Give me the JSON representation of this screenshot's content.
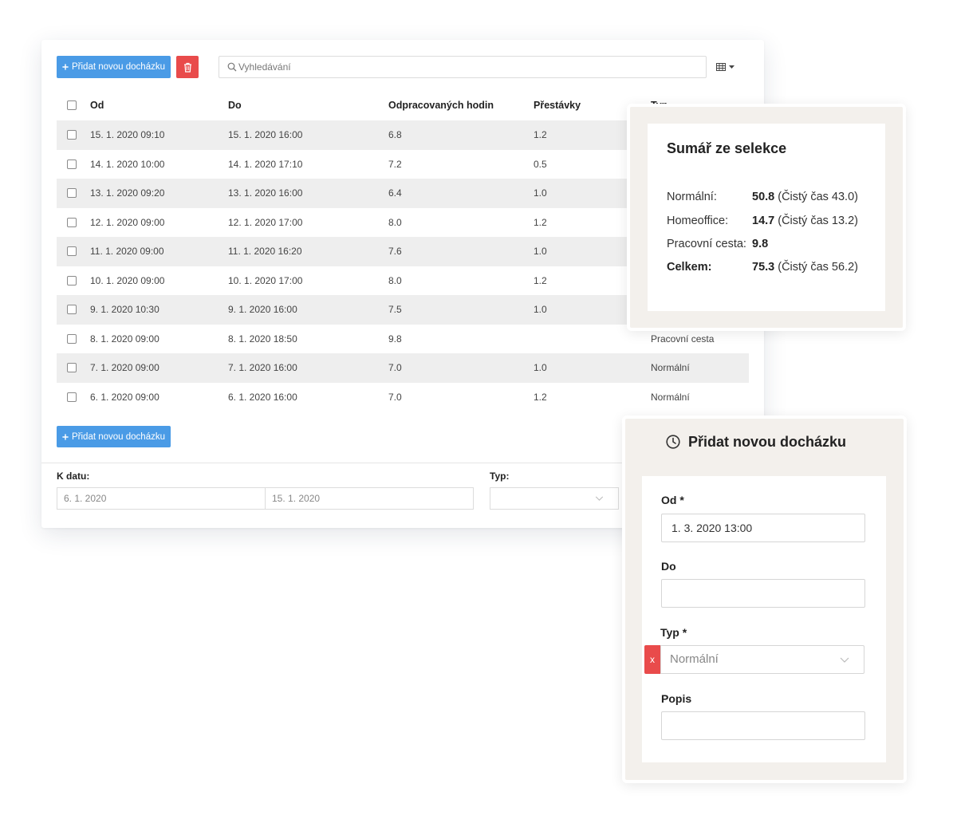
{
  "colors": {
    "primary": "#4a9be6",
    "danger": "#e94b4b",
    "panel_bg": "#f3f0ec",
    "stripe": "#eeeeee"
  },
  "toolbar": {
    "add_button": {
      "icon": "plus-icon",
      "label": "Přidat novou docházku"
    },
    "delete_button": {
      "icon": "trash-icon"
    },
    "search": {
      "icon": "search-icon",
      "placeholder": "Vyhledávání"
    },
    "columns_toggle": {
      "icon": "table-icon"
    }
  },
  "table": {
    "columns": {
      "od": "Od",
      "do": "Do",
      "hours": "Odpracovaných hodin",
      "breaks": "Přestávky",
      "type": "Typ"
    },
    "rows": [
      {
        "od": "15. 1. 2020 09:10",
        "do": "15. 1. 2020 16:00",
        "hours": "6.8",
        "breaks": "1.2"
      },
      {
        "od": "14. 1. 2020 10:00",
        "do": "14. 1. 2020 17:10",
        "hours": "7.2",
        "breaks": "0.5"
      },
      {
        "od": "13. 1. 2020 09:20",
        "do": "13. 1. 2020 16:00",
        "hours": "6.4",
        "breaks": "1.0"
      },
      {
        "od": "12. 1. 2020 09:00",
        "do": "12. 1. 2020 17:00",
        "hours": "8.0",
        "breaks": "1.2"
      },
      {
        "od": "11. 1. 2020 09:00",
        "do": "11. 1. 2020 16:20",
        "hours": "7.6",
        "breaks": "1.0"
      },
      {
        "od": "10. 1. 2020 09:00",
        "do": "10. 1. 2020 17:00",
        "hours": "8.0",
        "breaks": "1.2"
      },
      {
        "od": "9. 1. 2020 10:30",
        "do": "9. 1. 2020 16:00",
        "hours": "7.5",
        "breaks": "1.0"
      },
      {
        "od": "8. 1. 2020 09:00",
        "do": "8. 1. 2020 18:50",
        "hours": "9.8",
        "type": "Pracovní cesta"
      },
      {
        "od": "7. 1. 2020 09:00",
        "do": "7. 1. 2020 16:00",
        "hours": "7.0",
        "breaks": "1.0",
        "type": "Normální"
      },
      {
        "od": "6. 1. 2020 09:00",
        "do": "6. 1. 2020 16:00",
        "hours": "7.0",
        "breaks": "1.2",
        "type": "Normální"
      }
    ]
  },
  "footer": {
    "add_button": {
      "icon": "plus-icon",
      "label": "Přidat novou docházku"
    }
  },
  "filters": {
    "date_label": "K datu:",
    "date_from": "6. 1. 2020",
    "date_to": "15. 1. 2020",
    "type_label": "Typ:"
  },
  "summary": {
    "title": "Sumář ze selekce",
    "rows": [
      {
        "label": "Normální:",
        "value": "50.8",
        "detail": "(Čistý čas 43.0)"
      },
      {
        "label": "Homeoffice:",
        "value": "14.7",
        "detail": "(Čistý čas 13.2)"
      },
      {
        "label": "Pracovní cesta:",
        "value": "9.8"
      },
      {
        "label": "Celkem:",
        "value": "75.3",
        "detail": "(Čistý čas 56.2)"
      }
    ]
  },
  "form": {
    "icon": "clock-icon",
    "title": "Přidat novou docházku",
    "fields": {
      "od": {
        "label": "Od *",
        "value": "1. 3. 2020 13:00"
      },
      "do": {
        "label": "Do"
      },
      "typ": {
        "label": "Typ *",
        "value": "Normální",
        "clear_label": "x"
      },
      "popis": {
        "label": "Popis"
      }
    }
  }
}
